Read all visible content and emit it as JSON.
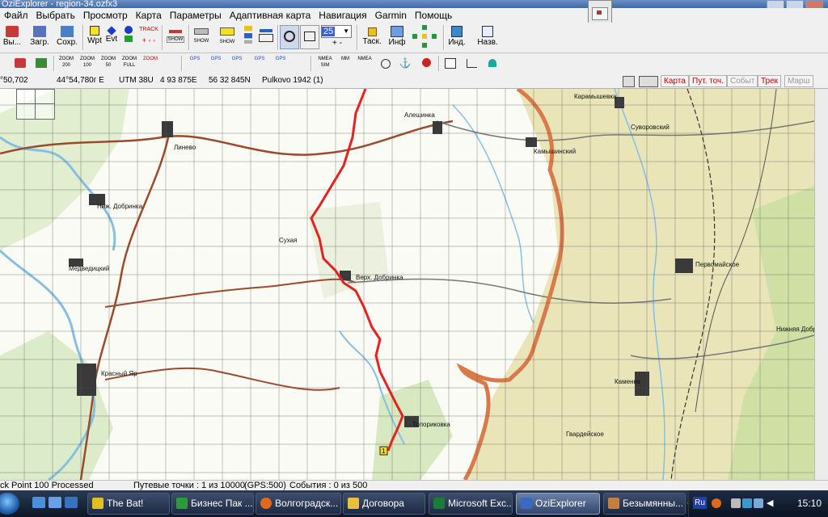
{
  "window": {
    "title": "OziExplorer - region-34.ozfx3"
  },
  "menu": [
    "Файл",
    "Выбрать",
    "Просмотр",
    "Карта",
    "Параметры",
    "Адаптивная карта",
    "Навигация",
    "Garmin",
    "Помощь"
  ],
  "toolbar": {
    "exit": "Вы...",
    "load": "Загр.",
    "save": "Сохр.",
    "wpt": "Wpt",
    "evt": "Evt",
    "track": "TRACK",
    "show1": "SHOW",
    "show2": "SHOW",
    "show3": "SHOW",
    "zoom_value": "25",
    "task": "Таск.",
    "info": "Инф",
    "index": "Инд.",
    "name": "Назв."
  },
  "toolbar2": {
    "zoom200": "ZOOM 200",
    "zoom100": "ZOOM 100",
    "zoom50": "ZOOM 50",
    "zoomfull": "ZOOM FULL",
    "zoom": "ZOOM",
    "gps1": "GPS",
    "gps2": "GPS",
    "gps3": "GPS",
    "gps4": "GPS",
    "gps5": "GPS",
    "nmea_sim": "NMEA SIM",
    "mm": "MM",
    "nmea": "NMEA"
  },
  "coords": {
    "lat": "°50,702",
    "lon": "44°54,780г E",
    "utm": "UTM 38U",
    "easting": "4 93 875E",
    "northing": "56 32 845N",
    "datum": "Pulkovo 1942 (1)"
  },
  "view_tabs": [
    {
      "label": "Карта",
      "enabled": true
    },
    {
      "label": "Пут. точ.",
      "enabled": true
    },
    {
      "label": "Событ",
      "enabled": false
    },
    {
      "label": "Трек",
      "enabled": true
    },
    {
      "label": "Марш",
      "enabled": false
    }
  ],
  "map_labels": {
    "place1": "Алешинка",
    "place2": "Линево",
    "place3": "Ниж. Добринка",
    "place4": "Медведицкий",
    "place5": "Верх. Добринка",
    "place6": "Красный Яр",
    "place7": "Камышинский",
    "place8": "Первомайское",
    "place9": "Каменка",
    "place10": "Гвардейское",
    "place11": "Топориковка",
    "place12": "Карамышевка",
    "place13": "Суворовский",
    "place14": "Сухая",
    "place15": "Нижняя Добринка",
    "waypoint": "1"
  },
  "status": {
    "left": "ck Point 100 Processed",
    "waypoints": "Путевые точки : 1 из 10000",
    "gps": "(GPS:500)",
    "events": "События : 0 из 500"
  },
  "taskbar": {
    "tasks": [
      {
        "label": "The Bat!",
        "active": false,
        "color": "#e0c020"
      },
      {
        "label": "Бизнес Пак ...",
        "active": false,
        "color": "#2a9a3a"
      },
      {
        "label": "Волгоградск...",
        "active": false,
        "color": "#e06a1a"
      },
      {
        "label": "Договора",
        "active": false,
        "color": "#e8c040"
      },
      {
        "label": "Microsoft Exc...",
        "active": false,
        "color": "#1e7a3a"
      },
      {
        "label": "OziExplorer",
        "active": true,
        "color": "#3a6ac0"
      },
      {
        "label": "Безымянны...",
        "active": false,
        "color": "#c08040"
      }
    ],
    "lang": "Ru",
    "clock": "15:10"
  },
  "colors": {
    "track": "#e5221f",
    "border_route": "#d97a4a",
    "grid": "#505050",
    "forest": "#cfe3b0",
    "steppe": "#e8e3b5",
    "water": "#9ccbe6",
    "road_brown": "#9b4a2a"
  }
}
